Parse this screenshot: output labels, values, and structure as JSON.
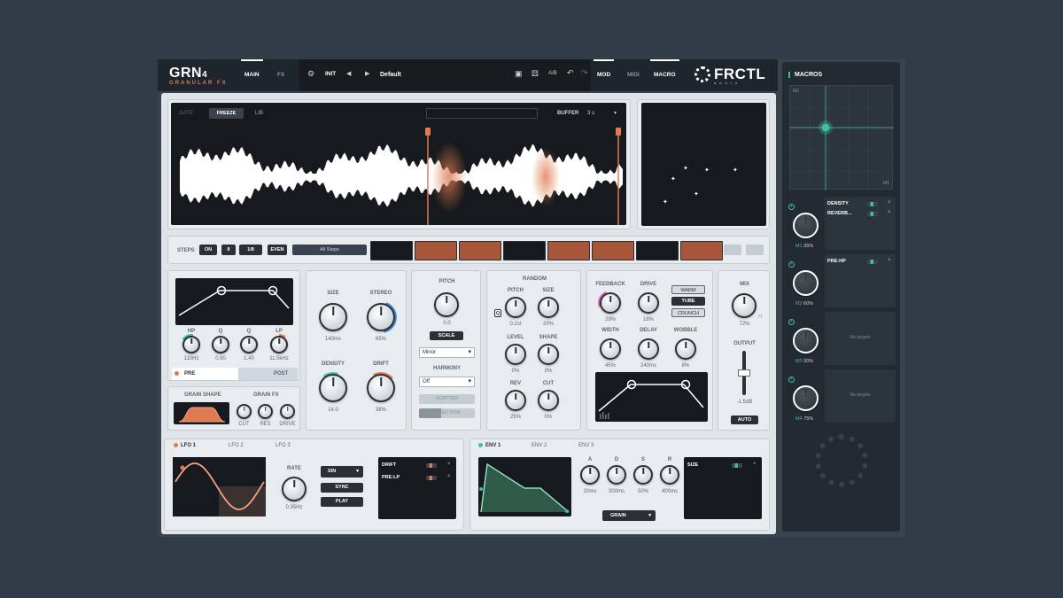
{
  "header": {
    "brand": "GRN",
    "brand_sub_num": "4",
    "brand_subtitle": "GRANULAR FX",
    "tabs": [
      "MAIN",
      "FX"
    ],
    "preset_label": "INIT",
    "preset_name": "Default",
    "ab_label": "A/B",
    "right_tabs": [
      "MOD",
      "MIDI",
      "MACRO"
    ],
    "logo": "FRCTL",
    "logo_sub": "audio"
  },
  "buffer": {
    "modes": [
      "GATE",
      "FREEZE",
      "LIB"
    ],
    "buffer_label": "BUFFER",
    "buffer_value": "3 s"
  },
  "steps": {
    "label": "STEPS",
    "on": "ON",
    "count": "8",
    "rate": "1/8",
    "even": "EVEN",
    "pattern": "All Steps",
    "active": [
      false,
      true,
      true,
      false,
      true,
      true,
      false,
      true
    ]
  },
  "filter": {
    "knobs": [
      {
        "label": "HP",
        "value": "110Hz"
      },
      {
        "label": "Q",
        "value": "0.90"
      },
      {
        "label": "Q",
        "value": "1.40"
      },
      {
        "label": "LP",
        "value": "11.5kHz"
      }
    ],
    "pre": "PRE",
    "post": "POST"
  },
  "grain_shape": {
    "label": "GRAIN SHAPE",
    "fx_label": "GRAIN FX",
    "fx": [
      "CUT",
      "RES",
      "DRIVE"
    ]
  },
  "grain": {
    "knobs": [
      {
        "label": "SIZE",
        "value": "140ms"
      },
      {
        "label": "STEREO",
        "value": "65%"
      },
      {
        "label": "DENSITY",
        "value": "14.0"
      },
      {
        "label": "DRIFT",
        "value": "38%"
      }
    ]
  },
  "pitch": {
    "label": "PITCH",
    "value": "0.0",
    "scale": "SCALE",
    "scale_value": "Minor",
    "harmony_label": "HARMONY",
    "harmony_value": "Off",
    "scatter": "SCATTER",
    "direction": "DIRECTION"
  },
  "random": {
    "label": "RANDOM",
    "knobs": [
      {
        "label": "PITCH",
        "value": "0.2st"
      },
      {
        "label": "SIZE",
        "value": "20%"
      },
      {
        "label": "LEVEL",
        "value": "0%"
      },
      {
        "label": "SHAPE",
        "value": "0%"
      },
      {
        "label": "REV",
        "value": "25%"
      },
      {
        "label": "CUT",
        "value": "0%"
      }
    ],
    "q": "Q"
  },
  "fx": {
    "knobs": [
      {
        "label": "FEEDBACK",
        "value": "29%"
      },
      {
        "label": "DRIVE",
        "value": "18%"
      },
      {
        "label": "WIDTH",
        "value": "45%"
      },
      {
        "label": "DELAY",
        "value": "240ms"
      },
      {
        "label": "WOBBLE",
        "value": "8%"
      }
    ],
    "modes": [
      "WARM",
      "TUBE",
      "CRUNCH"
    ]
  },
  "output": {
    "mix_label": "MIX",
    "mix_value": "72%",
    "out_label": "OUTPUT",
    "out_value": "-1.5dB",
    "auto": "AUTO"
  },
  "lfo": {
    "tabs": [
      "LFO 1",
      "LFO 2",
      "LFO 3"
    ],
    "rate_label": "RATE",
    "rate_value": "0.35Hz",
    "shape": "SIN",
    "sync": "SYNC",
    "play": "PLAY",
    "targets": [
      "DRIFT",
      "PRE:LP"
    ]
  },
  "env": {
    "tabs": [
      "ENV 1",
      "ENV 2",
      "ENV 3"
    ],
    "knobs": [
      {
        "label": "A",
        "value": "20ms"
      },
      {
        "label": "D",
        "value": "300ms"
      },
      {
        "label": "S",
        "value": "50%"
      },
      {
        "label": "R",
        "value": "400ms"
      }
    ],
    "mode": "GRAIN",
    "targets": [
      "SIZE"
    ]
  },
  "macros": {
    "title": "MACROS",
    "pad_y": "M2",
    "pad_x": "M1",
    "items": [
      {
        "name": "M1",
        "value": "35%",
        "targets": [
          "DENSITY",
          "REVERB..."
        ]
      },
      {
        "name": "M2",
        "value": "60%",
        "targets": [
          "PRE:HP"
        ]
      },
      {
        "name": "M3",
        "value": "20%",
        "targets": [],
        "empty": "No targets"
      },
      {
        "name": "M4",
        "value": "75%",
        "targets": [],
        "empty": "No targets"
      }
    ]
  },
  "colors": {
    "accent": "#e07a52",
    "teal": "#3fbf9f",
    "blue": "#4a90e2",
    "pink": "#e066c4",
    "dark": "#161a1e"
  }
}
